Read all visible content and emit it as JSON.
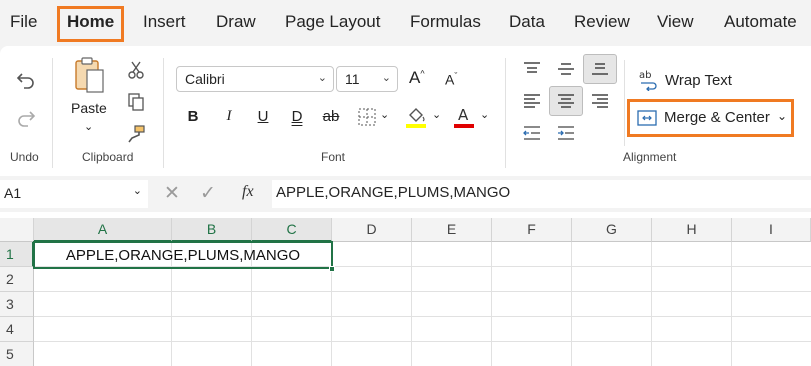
{
  "menu": {
    "tabs": [
      "File",
      "Home",
      "Insert",
      "Draw",
      "Page Layout",
      "Formulas",
      "Data",
      "Review",
      "View",
      "Automate"
    ],
    "active_tab": "Home"
  },
  "ribbon": {
    "undo": {
      "group_label": "Undo"
    },
    "clipboard": {
      "group_label": "Clipboard",
      "paste_label": "Paste"
    },
    "font": {
      "group_label": "Font",
      "font_name": "Calibri",
      "font_size": "11",
      "bold": "B",
      "italic": "I",
      "underline": "U",
      "double_underline": "D",
      "strikethrough": "ab",
      "highlight_color": "#ffff00",
      "font_color": "#e00000"
    },
    "alignment": {
      "group_label": "Alignment",
      "wrap_text": "Wrap Text",
      "merge_center": "Merge & Center"
    }
  },
  "formula_bar": {
    "name_box": "A1",
    "fx": "fx",
    "formula": "APPLE,ORANGE,PLUMS,MANGO"
  },
  "sheet": {
    "columns": [
      "A",
      "B",
      "C",
      "D",
      "E",
      "F",
      "G",
      "H",
      "I"
    ],
    "rows": [
      "1",
      "2",
      "3",
      "4",
      "5"
    ],
    "cell_a1": "APPLE,ORANGE,PLUMS,MANGO"
  },
  "colors": {
    "highlight_box": "#f07a22",
    "excel_green": "#217346"
  }
}
